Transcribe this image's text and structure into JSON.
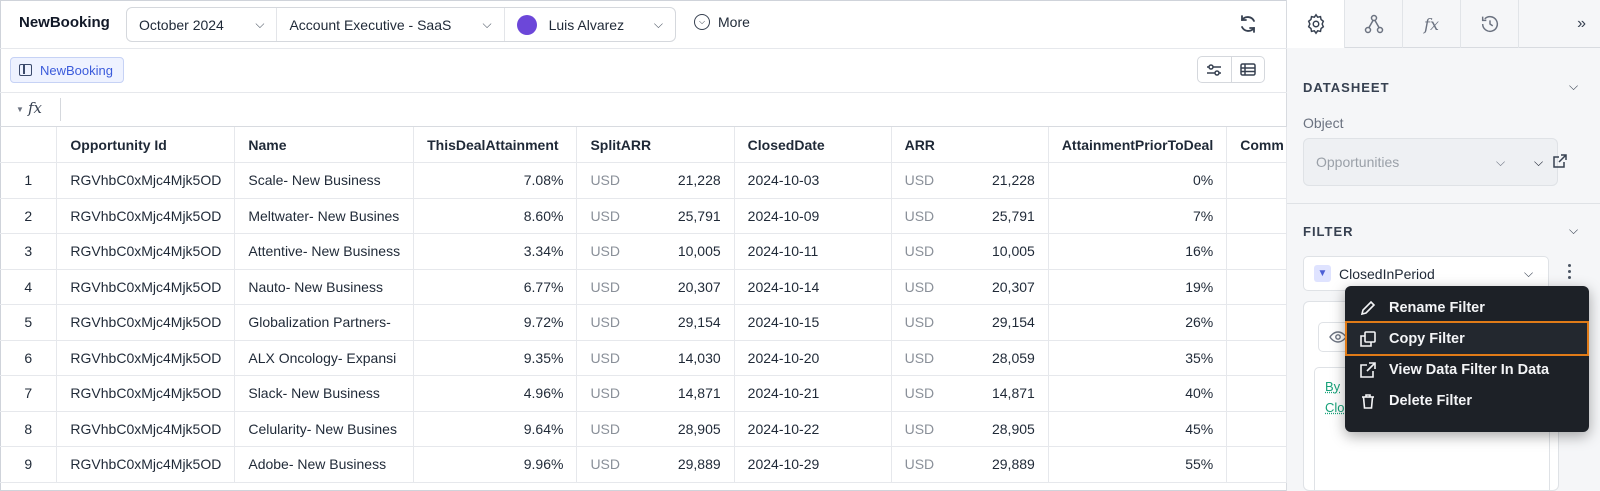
{
  "app": {
    "title": "NewBooking"
  },
  "toolbar": {
    "period": "October 2024",
    "plan": "Account Executive - SaaS",
    "user": "Luis Alvarez",
    "more_label": "More"
  },
  "sheet_tab": {
    "label": "NewBooking"
  },
  "formula_bar": {
    "fx": "fx"
  },
  "table": {
    "columns": [
      "Opportunity Id",
      "Name",
      "ThisDealAttainment",
      "SplitARR",
      "ClosedDate",
      "ARR",
      "AttainmentPriorToDeal",
      "Comm"
    ],
    "rows": [
      {
        "n": "1",
        "id": "RGVhbC0xMjc4Mjk5OD",
        "name": "Scale- New Business",
        "att": "7.08%",
        "sccy": "USD",
        "split": "21,228",
        "date": "2024-10-03",
        "accy": "USD",
        "arr": "21,228",
        "prior": "0%"
      },
      {
        "n": "2",
        "id": "RGVhbC0xMjc4Mjk5OD",
        "name": "Meltwater- New Busines",
        "att": "8.60%",
        "sccy": "USD",
        "split": "25,791",
        "date": "2024-10-09",
        "accy": "USD",
        "arr": "25,791",
        "prior": "7%"
      },
      {
        "n": "3",
        "id": "RGVhbC0xMjc4Mjk5OD",
        "name": "Attentive- New Business",
        "att": "3.34%",
        "sccy": "USD",
        "split": "10,005",
        "date": "2024-10-11",
        "accy": "USD",
        "arr": "10,005",
        "prior": "16%"
      },
      {
        "n": "4",
        "id": "RGVhbC0xMjc4Mjk5OD",
        "name": "Nauto- New Business",
        "att": "6.77%",
        "sccy": "USD",
        "split": "20,307",
        "date": "2024-10-14",
        "accy": "USD",
        "arr": "20,307",
        "prior": "19%"
      },
      {
        "n": "5",
        "id": "RGVhbC0xMjc4Mjk5OD",
        "name": "Globalization Partners-",
        "att": "9.72%",
        "sccy": "USD",
        "split": "29,154",
        "date": "2024-10-15",
        "accy": "USD",
        "arr": "29,154",
        "prior": "26%"
      },
      {
        "n": "6",
        "id": "RGVhbC0xMjc4Mjk5OD",
        "name": "ALX Oncology- Expansi",
        "att": "9.35%",
        "sccy": "USD",
        "split": "14,030",
        "date": "2024-10-20",
        "accy": "USD",
        "arr": "28,059",
        "prior": "35%"
      },
      {
        "n": "7",
        "id": "RGVhbC0xMjc4Mjk5OD",
        "name": "Slack- New Business",
        "att": "4.96%",
        "sccy": "USD",
        "split": "14,871",
        "date": "2024-10-21",
        "accy": "USD",
        "arr": "14,871",
        "prior": "40%"
      },
      {
        "n": "8",
        "id": "RGVhbC0xMjc4Mjk5OD",
        "name": "Celularity- New Busines",
        "att": "9.64%",
        "sccy": "USD",
        "split": "28,905",
        "date": "2024-10-22",
        "accy": "USD",
        "arr": "28,905",
        "prior": "45%"
      },
      {
        "n": "9",
        "id": "RGVhbC0xMjc4Mjk5OD",
        "name": "Adobe- New Business",
        "att": "9.96%",
        "sccy": "USD",
        "split": "29,889",
        "date": "2024-10-29",
        "accy": "USD",
        "arr": "29,889",
        "prior": "55%"
      }
    ]
  },
  "panel": {
    "tabs": [
      "gear-icon",
      "graph-icon",
      "fx-icon",
      "history-icon"
    ],
    "datasheet_heading": "DATASHEET",
    "object_label": "Object",
    "object_value": "Opportunities",
    "filter_heading": "FILTER",
    "filter_value": "ClosedInPeriod",
    "code_line1": "By",
    "code_line2": "Clo"
  },
  "context_menu": {
    "items": [
      "Rename Filter",
      "Copy Filter",
      "View Data Filter In Data",
      "Delete Filter"
    ],
    "highlight_color": "#e07b18"
  },
  "colors": {
    "accent": "#3b5bdb",
    "avatar": "#6c47d9",
    "menu_bg": "#1d2127"
  }
}
